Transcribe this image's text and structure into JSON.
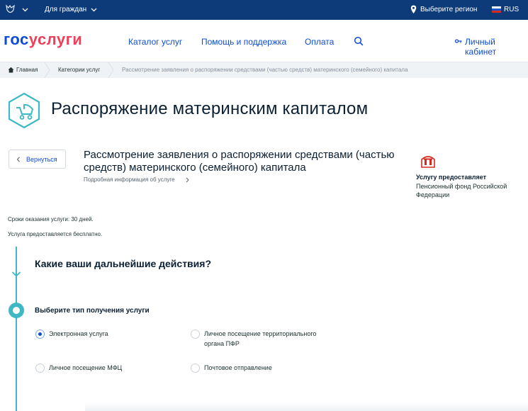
{
  "topbar": {
    "citizens": "Для граждан",
    "region": "Выберите регион",
    "lang": "RUS"
  },
  "header": {
    "logo_part1": "гос",
    "logo_part2": "услуги",
    "nav": [
      "Каталог услуг",
      "Помощь и поддержка",
      "Оплата"
    ],
    "cabinet": "Личный кабинет"
  },
  "breadcrumbs": {
    "home": "Главная",
    "categories": "Категории услуг",
    "current": "Рассмотрение заявления о распоряжении средствами (частью средств) материнского (семейного) капитала"
  },
  "page": {
    "title": "Распоряжение материнским капиталом",
    "back": "Вернуться",
    "service_name": "Рассмотрение заявления о распоряжении средствами (частью средств) материнского (семейного) капитала",
    "more_info": "Подробная информация об услуге",
    "provider_label": "Услугу предоставляет",
    "provider_name": "Пенсионный фонд Российской Федерации",
    "term": "Сроки оказания услуги: 30 дней.",
    "free": "Услуга предоставляется бесплатно."
  },
  "form": {
    "question": "Какие ваши дальнейшие действия?",
    "choose": "Выберите тип получения услуги",
    "options": [
      {
        "label": "Электронная услуга",
        "selected": true
      },
      {
        "label": "Личное посещение территориального органа ПФР",
        "selected": false
      },
      {
        "label": "Личное посещение МФЦ",
        "selected": false
      },
      {
        "label": "Почтовое отправление",
        "selected": false
      }
    ]
  },
  "colors": {
    "topbar": "#0d3b7a",
    "brand_blue": "#0d4cd3",
    "brand_red": "#ee3f58",
    "accent_teal": "#3db8c4"
  }
}
